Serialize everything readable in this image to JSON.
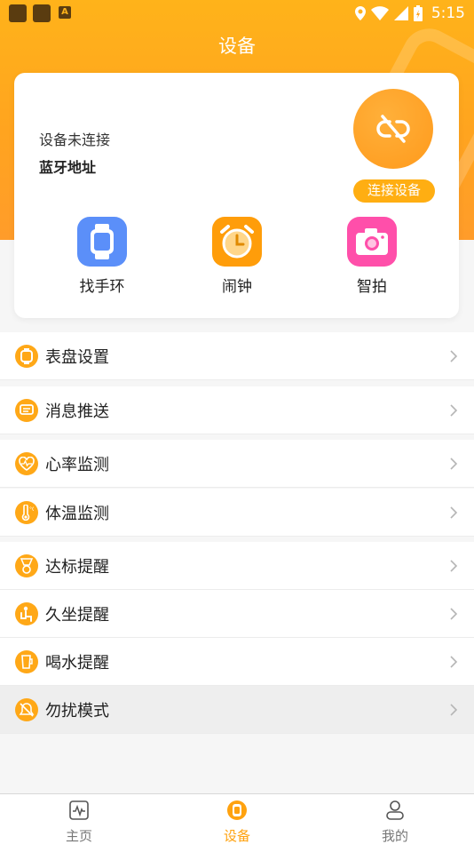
{
  "status_bar": {
    "time": "5:15",
    "notif_letter": "A"
  },
  "page_title": "设备",
  "device_card": {
    "status": "设备未连接",
    "address_label": "蓝牙地址",
    "connect_label": "连接设备",
    "quick_actions": [
      {
        "label": "找手环",
        "icon": "watch-icon",
        "color": "#5b8ff9"
      },
      {
        "label": "闹钟",
        "icon": "alarm-clock-icon",
        "color": "#ff9d0a"
      },
      {
        "label": "智拍",
        "icon": "camera-icon",
        "color": "#ff4faa"
      }
    ]
  },
  "settings": [
    {
      "label": "表盘设置",
      "icon": "watch-face-icon"
    },
    {
      "label": "消息推送",
      "icon": "message-icon"
    },
    {
      "label": "心率监测",
      "icon": "heart-rate-icon"
    },
    {
      "label": "体温监测",
      "icon": "thermometer-icon"
    },
    {
      "label": "达标提醒",
      "icon": "goal-icon"
    },
    {
      "label": "久坐提醒",
      "icon": "sedentary-icon"
    },
    {
      "label": "喝水提醒",
      "icon": "drink-icon"
    },
    {
      "label": "勿扰模式",
      "icon": "do-not-disturb-icon"
    }
  ],
  "tabs": [
    {
      "label": "主页",
      "icon": "home-chart-icon"
    },
    {
      "label": "设备",
      "icon": "device-watch-icon"
    },
    {
      "label": "我的",
      "icon": "profile-icon"
    }
  ],
  "colors": {
    "accent": "#ffa817",
    "header": "#ffb31a"
  }
}
